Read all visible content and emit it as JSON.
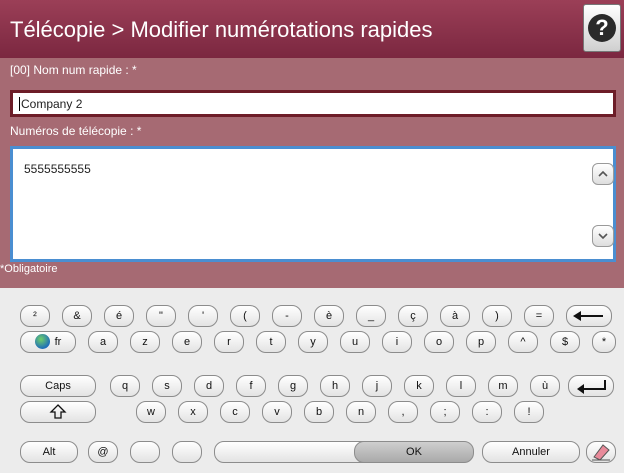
{
  "header": {
    "title": "Télécopie > Modifier numérotations rapides",
    "help_glyph": "?"
  },
  "form": {
    "name_label": "[00] Nom num rapide : *",
    "name_value": "Company 2",
    "fax_label": "Numéros de télécopie : *",
    "fax_value": "5555555555",
    "required_note": "*Obligatoire"
  },
  "keyboard": {
    "row1": [
      "²",
      "&",
      "é",
      "\"",
      "'",
      "(",
      "-",
      "è",
      "_",
      "ç",
      "à",
      ")",
      "="
    ],
    "row2_lang": "fr",
    "row2": [
      "a",
      "z",
      "e",
      "r",
      "t",
      "y",
      "u",
      "i",
      "o",
      "p",
      "^",
      "$",
      "*"
    ],
    "caps": "Caps",
    "row3": [
      "q",
      "s",
      "d",
      "f",
      "g",
      "h",
      "j",
      "k",
      "l",
      "m",
      "ù"
    ],
    "row4": [
      "w",
      "x",
      "c",
      "v",
      "b",
      "n",
      ",",
      ";",
      ":",
      "!"
    ],
    "alt": "Alt",
    "at": "@",
    "ok": "OK",
    "cancel": "Annuler"
  }
}
